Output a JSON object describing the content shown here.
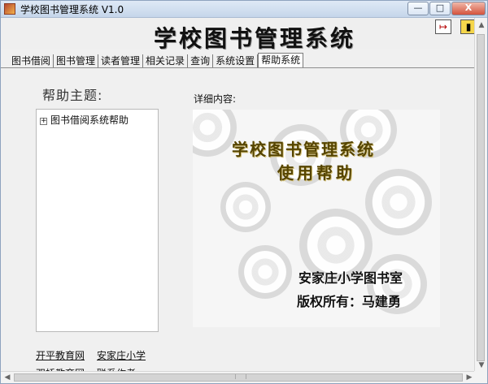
{
  "window": {
    "title": "学校图书管理系统 V1.0",
    "controls": {
      "minimize": "—",
      "maximize": "□",
      "close": "X"
    }
  },
  "banner": {
    "title": "学校图书管理系统"
  },
  "tabs": [
    "图书借阅",
    "图书管理",
    "读者管理",
    "相关记录",
    "查询",
    "系统设置",
    "帮助系统"
  ],
  "help": {
    "topics_label": "帮助主题:",
    "tree_items": [
      "图书借阅系统帮助"
    ],
    "detail_label": "详细内容:",
    "image": {
      "line1": "学校图书管理系统",
      "line2": "使用帮助",
      "footer1": "安家庄小学图书室",
      "footer2": "版权所有：马建勇"
    }
  },
  "links": [
    "开平教育网",
    "安家庄小学",
    "双桥教育网",
    "联系作者"
  ],
  "icons": {
    "app": "book-icon",
    "exit": "exit-arrow-icon",
    "door": "door-icon"
  },
  "colors": {
    "title_bar": "#dfe9f6",
    "close_button": "#d4533d",
    "image_title": "#554400"
  }
}
